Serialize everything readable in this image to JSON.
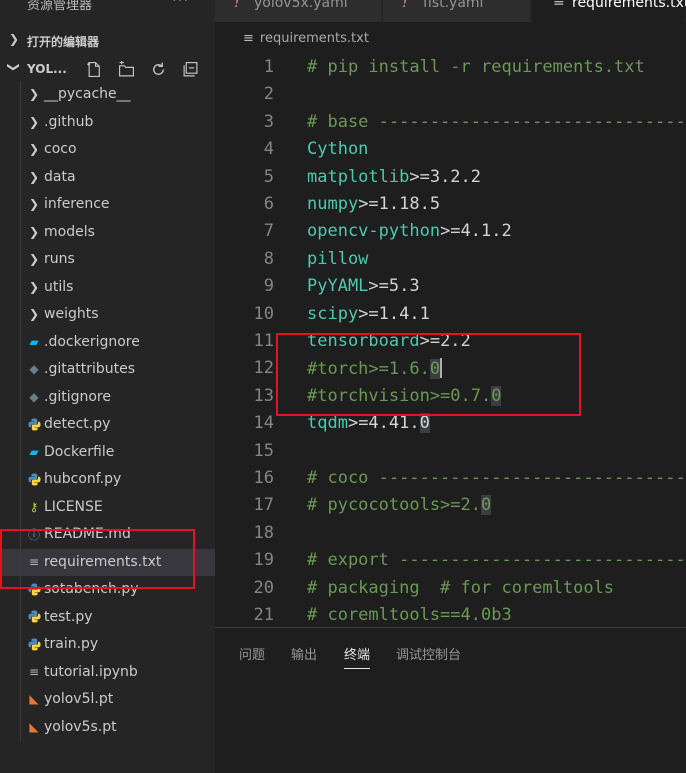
{
  "sidebar": {
    "title": "资源管理器",
    "more": "···",
    "open_editors": "打开的编辑器",
    "project": "YOL...",
    "items": [
      {
        "label": "__pycache__",
        "icon": "chevron-right-icon"
      },
      {
        "label": ".github",
        "icon": "chevron-right-icon"
      },
      {
        "label": "coco",
        "icon": "chevron-right-icon"
      },
      {
        "label": "data",
        "icon": "chevron-right-icon"
      },
      {
        "label": "inference",
        "icon": "chevron-right-icon"
      },
      {
        "label": "models",
        "icon": "chevron-right-icon"
      },
      {
        "label": "runs",
        "icon": "chevron-right-icon"
      },
      {
        "label": "utils",
        "icon": "chevron-right-icon"
      },
      {
        "label": "weights",
        "icon": "chevron-right-icon"
      },
      {
        "label": ".dockerignore",
        "icon": "docker-icon"
      },
      {
        "label": ".gitattributes",
        "icon": "git-icon"
      },
      {
        "label": ".gitignore",
        "icon": "git-icon"
      },
      {
        "label": "detect.py",
        "icon": "python-icon"
      },
      {
        "label": "Dockerfile",
        "icon": "docker-icon"
      },
      {
        "label": "hubconf.py",
        "icon": "python-icon"
      },
      {
        "label": "LICENSE",
        "icon": "license-key-icon"
      },
      {
        "label": "README.md",
        "icon": "info-icon"
      },
      {
        "label": "requirements.txt",
        "icon": "text-lines-icon"
      },
      {
        "label": "sotabench.py",
        "icon": "python-icon"
      },
      {
        "label": "test.py",
        "icon": "python-icon"
      },
      {
        "label": "train.py",
        "icon": "python-icon"
      },
      {
        "label": "tutorial.ipynb",
        "icon": "text-lines-icon"
      },
      {
        "label": "yolov5l.pt",
        "icon": "rss-icon"
      },
      {
        "label": "yolov5s.pt",
        "icon": "rss-icon"
      }
    ]
  },
  "tabs": [
    {
      "label": "yolov5x.yaml",
      "bang": "!"
    },
    {
      "label": "fist.yaml",
      "bang": "!"
    },
    {
      "label": "requirements.txt",
      "bang": ""
    }
  ],
  "breadcrumb": "requirements.txt",
  "editor": {
    "line_numbers": [
      "1",
      "2",
      "3",
      "4",
      "5",
      "6",
      "7",
      "8",
      "9",
      "10",
      "11",
      "12",
      "13",
      "14",
      "15",
      "16",
      "17",
      "18",
      "19",
      "20",
      "21"
    ],
    "lines": [
      {
        "a": "# pip install -r requirements.txt",
        "b": "",
        "c": ""
      },
      {
        "a": "",
        "b": "",
        "c": ""
      },
      {
        "a": "# base ----------------------------------------",
        "b": "",
        "c": ""
      },
      {
        "a": "Cython",
        "b": "",
        "c": ""
      },
      {
        "a": "matplotlib",
        "b": ">=3.2.2",
        "c": ""
      },
      {
        "a": "numpy",
        "b": ">=1.18.5",
        "c": ""
      },
      {
        "a": "opencv-python",
        "b": ">=4.1.2",
        "c": ""
      },
      {
        "a": "pillow",
        "b": "",
        "c": ""
      },
      {
        "a": "PyYAML",
        "b": ">=5.3",
        "c": ""
      },
      {
        "a": "scipy",
        "b": ">=1.4.1",
        "c": ""
      },
      {
        "a": "tensorboard",
        "b": ">=2.2",
        "c": ""
      },
      {
        "a": "#torch>=1.6.",
        "b": "0",
        "c": ""
      },
      {
        "a": "#torchvision>=0.7.",
        "b": "0",
        "c": ""
      },
      {
        "a": "tqdm",
        "b": ">=4.41.",
        "c": "0"
      },
      {
        "a": "",
        "b": "",
        "c": ""
      },
      {
        "a": "# coco ----------------------------------------",
        "b": "",
        "c": ""
      },
      {
        "a": "# pycocotools>=2.",
        "b": "0",
        "c": ""
      },
      {
        "a": "",
        "b": "",
        "c": ""
      },
      {
        "a": "# export --------------------------------------",
        "b": "",
        "c": ""
      },
      {
        "a": "# packaging  # for coremltools",
        "b": "",
        "c": ""
      },
      {
        "a": "# coremltools==4.0b3",
        "b": "",
        "c": ""
      }
    ]
  },
  "panel": {
    "tabs": [
      "问题",
      "输出",
      "终端",
      "调试控制台"
    ],
    "active": "终端"
  },
  "colors": {
    "comment": "#6a9955",
    "package": "#4ec9b0",
    "highlight_box": "#e81123"
  }
}
